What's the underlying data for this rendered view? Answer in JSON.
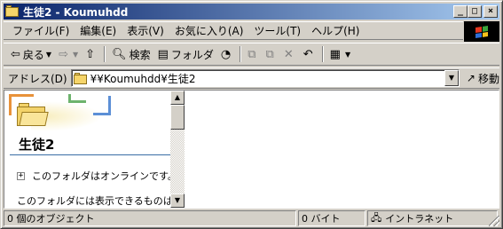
{
  "window": {
    "title": "生徒2 - Koumuhdd",
    "minimize_glyph": "_",
    "maximize_glyph": "□",
    "close_glyph": "×"
  },
  "menu": {
    "items": [
      "ファイル(F)",
      "編集(E)",
      "表示(V)",
      "お気に入り(A)",
      "ツール(T)",
      "ヘルプ(H)"
    ]
  },
  "toolbar": {
    "back_label": "戻る",
    "search_label": "検索",
    "folders_label": "フォルダ",
    "icons": [
      "back-arrow-icon",
      "forward-arrow-icon",
      "up-folder-icon",
      "search-icon",
      "folders-icon",
      "history-icon",
      "move-to-icon",
      "copy-to-icon",
      "delete-icon",
      "undo-icon",
      "views-icon"
    ]
  },
  "address": {
    "label": "アドレス(D)",
    "value": "¥¥Koumuhdd¥生徒2",
    "go_label": "移動"
  },
  "left_pane": {
    "title": "生徒2",
    "online_text": "このフォルダはオンラインです。",
    "no_items_text": "このフォルダには表示できるものはあり"
  },
  "status": {
    "objects": "0 個のオブジェクト",
    "size": "0 バイト",
    "zone": "イントラネット"
  }
}
